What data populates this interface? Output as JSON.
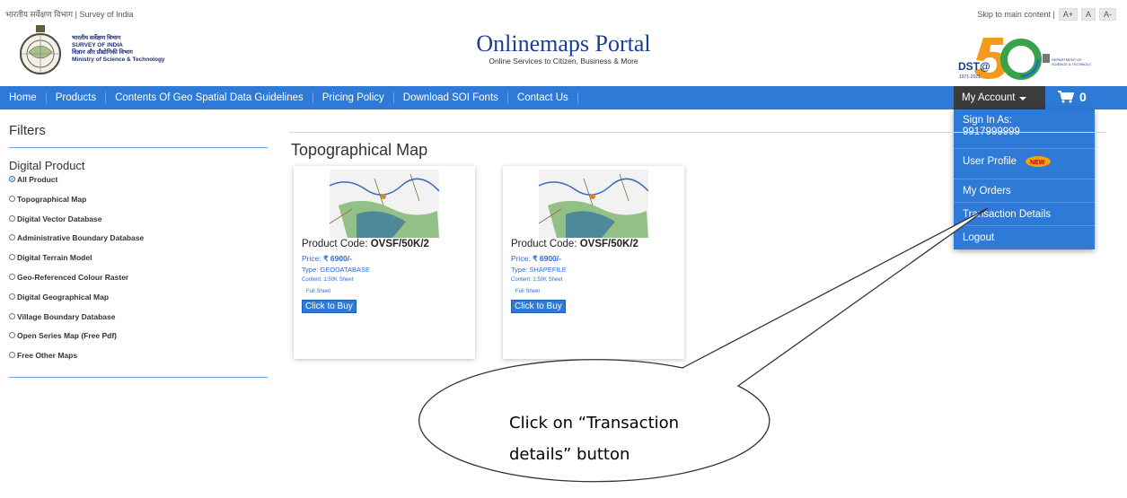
{
  "topbar": {
    "site_name": "भारतीय सर्वेक्षण विभाग | Survey of India",
    "skip_link": "Skip to main content |",
    "font_buttons": [
      "A+",
      "A",
      "A-"
    ]
  },
  "header": {
    "org_lines": [
      "भारतीय सर्वेक्षण विभाग",
      "SURVEY OF INDIA",
      "विज्ञान और प्रौद्योगिकी विभाग",
      "Ministry of Science & Technology"
    ],
    "portal_title": "Onlinemaps Portal",
    "portal_subtitle": "Online Services to Citizen, Business & More",
    "dst_logo_text": "DST@",
    "dst_years": "1971-2021",
    "dst_dept": "DEPARTMENT OF SCIENCE & TECHNOLOGY"
  },
  "nav": {
    "items": [
      "Home",
      "Products",
      "Contents Of Geo Spatial Data Guidelines",
      "Pricing Policy",
      "Download SOI Fonts",
      "Contact Us"
    ],
    "account_label": "My Account",
    "cart_count": "0"
  },
  "account_menu": {
    "sign_in_label": "Sign In As:",
    "sign_in_user": "9917999999",
    "items": [
      "User Profile",
      "My Orders",
      "Transaction Details",
      "Logout"
    ]
  },
  "filters": {
    "title": "Filters",
    "group_title": "Digital Product",
    "options": [
      {
        "label": "All Product",
        "selected": true
      },
      {
        "label": "Topographical Map",
        "selected": false
      },
      {
        "label": "Digital Vector Database",
        "selected": false
      },
      {
        "label": "Administrative Boundary Database",
        "selected": false
      },
      {
        "label": "Digital Terrain Model",
        "selected": false
      },
      {
        "label": "Geo-Referenced Colour Raster",
        "selected": false
      },
      {
        "label": "Digital Geographical Map",
        "selected": false
      },
      {
        "label": "Village Boundary Database",
        "selected": false
      },
      {
        "label": "Open Series Map (Free Pdf)",
        "selected": false
      },
      {
        "label": "Free Other Maps",
        "selected": false
      }
    ]
  },
  "main": {
    "section_title": "Topographical Map",
    "products": [
      {
        "code_label": "Product Code:",
        "code": "OVSF/50K/2",
        "price_label": "Price:",
        "price": "₹ 6900/-",
        "type": "Type: GEODATABASE",
        "content": "Content: 1:50K Sheet",
        "sheet": "Full Sheet",
        "buy_label": "Click to Buy"
      },
      {
        "code_label": "Product Code:",
        "code": "OVSF/50K/2",
        "price_label": "Price:",
        "price": "₹ 6900/-",
        "type": "Type: SHAPEFILE",
        "content": "Content: 1:50K Sheet",
        "sheet": "Full Sheet",
        "buy_label": "Click to Buy"
      }
    ]
  },
  "callout": {
    "line1": "Click on “Transaction",
    "line2": "details” button"
  },
  "colors": {
    "nav_blue": "#2f7ad6",
    "account_dark": "#3c3c3c",
    "title_blue": "#1b3d99"
  }
}
